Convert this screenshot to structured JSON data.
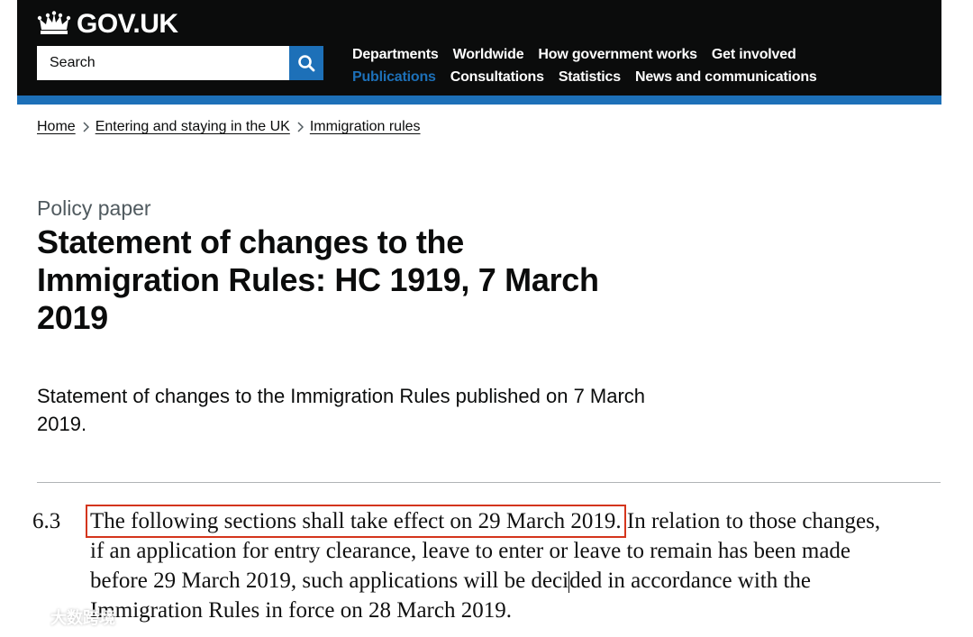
{
  "colors": {
    "header_bg": "#0b0c0c",
    "accent_bar": "#1d70b8",
    "search_button": "#1d70b8",
    "active_link": "#1d70b8",
    "highlight_box": "#d4351c"
  },
  "header": {
    "logo_text": "GOV.UK",
    "logo_icon": "crown-icon",
    "search": {
      "placeholder": "Search",
      "button_icon": "search-icon"
    },
    "nav": {
      "row1": [
        "Departments",
        "Worldwide",
        "How government works",
        "Get involved"
      ],
      "row2": [
        "Publications",
        "Consultations",
        "Statistics",
        "News and communications"
      ],
      "active": "Publications"
    }
  },
  "breadcrumbs": [
    "Home",
    "Entering and staying in the UK",
    "Immigration rules"
  ],
  "page": {
    "caption": "Policy paper",
    "title": "Statement of changes to the Immigration Rules: HC 1919, 7 March 2019",
    "lede": "Statement of changes to the Immigration Rules published on 7 March 2019."
  },
  "excerpt": {
    "number": "6.3",
    "highlighted": "The following sections shall take effect on 29 March 2019.",
    "line1_rest": " In relation to those changes,",
    "line2": "if an application for entry clearance, leave to enter or leave to remain has been made",
    "line3_a": "before 29 March 2019, such applications will be deci",
    "line3_b": "ded in accordance with the",
    "line4": "Immigration Rules in force on 28 March 2019."
  },
  "watermark": {
    "text": "大数跨境"
  }
}
